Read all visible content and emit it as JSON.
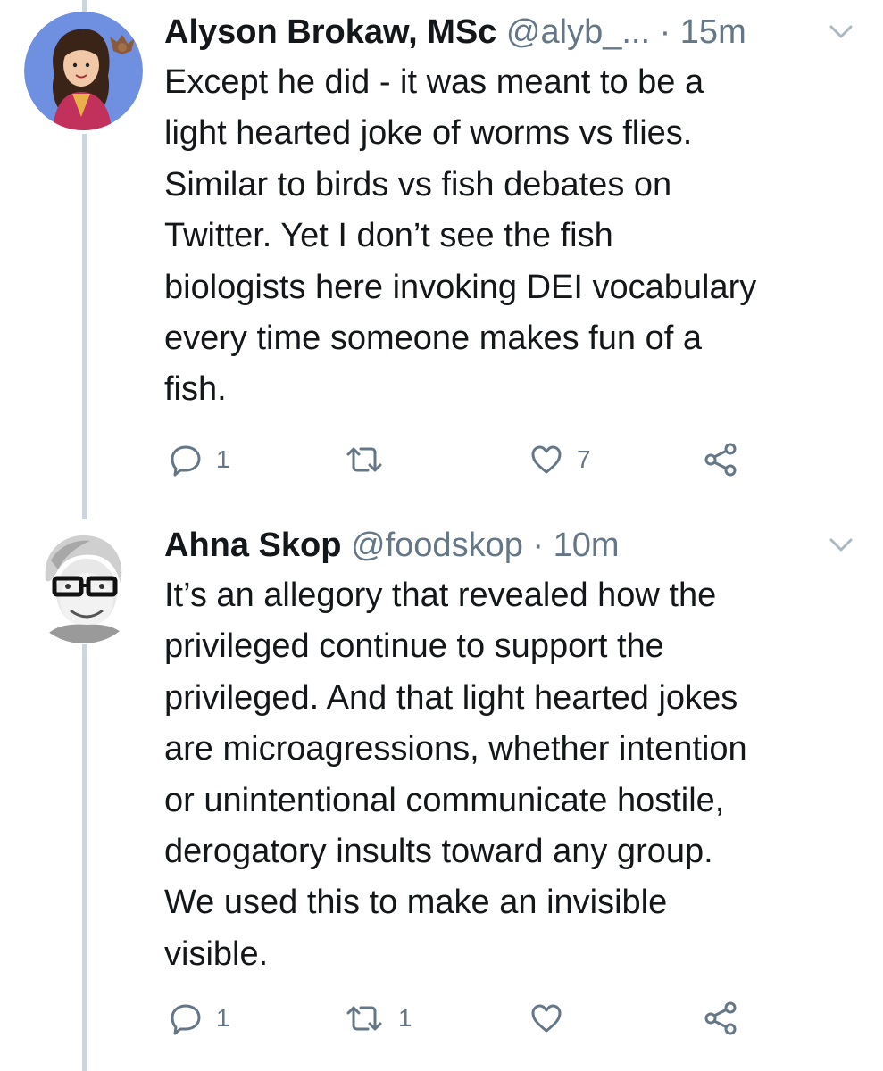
{
  "tweets": [
    {
      "author_name": "Alyson Brokaw, MSc",
      "handle": "@alyb_...",
      "separator": "·",
      "time": "15m",
      "text": "Except he did - it was meant to be a\nlight hearted joke of worms vs flies.\nSimilar to birds vs fish debates on\nTwitter. Yet I don’t see the fish\nbiologists here invoking DEI vocabulary\nevery time someone makes fun of a\nfish.",
      "reply_count": "1",
      "retweet_count": "",
      "like_count": "7"
    },
    {
      "author_name": "Ahna Skop",
      "handle": "@foodskop",
      "separator": "·",
      "time": "10m",
      "text": "It’s an allegory that revealed how the\nprivileged continue to support the\nprivileged. And that light hearted jokes\nare microagressions, whether intention\nor unintentional communicate hostile,\nderogatory insults toward any group.\nWe used this to make an invisible\nvisible.",
      "reply_count": "1",
      "retweet_count": "1",
      "like_count": ""
    }
  ],
  "icons": {
    "reply": "reply-icon",
    "retweet": "retweet-icon",
    "like": "heart-icon",
    "share": "share-icon",
    "menu": "chevron-down-icon"
  },
  "colors": {
    "text": "#14171a",
    "secondary": "#657786",
    "thread_line": "#ccd6dd"
  }
}
